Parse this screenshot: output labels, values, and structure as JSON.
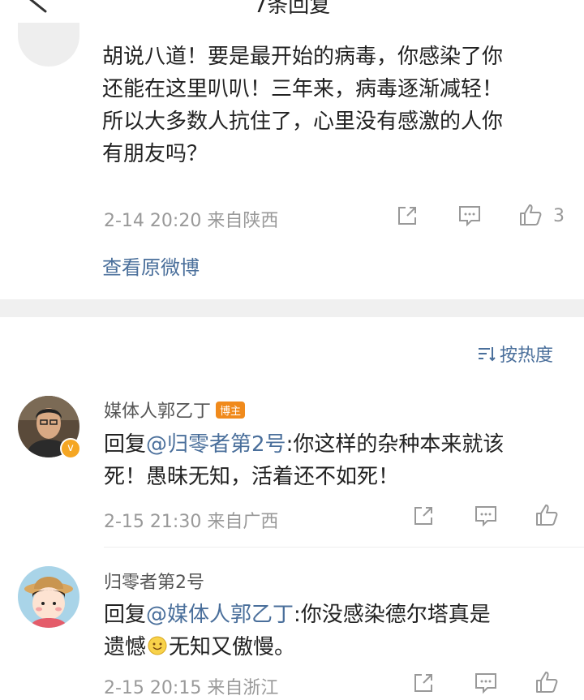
{
  "header": {
    "title": "7条回复"
  },
  "post": {
    "text_lines": [
      "胡说八道！要是最开始的病毒，你感染了你",
      "还能在这里叭叭！三年来，病毒逐渐减轻！",
      "所以大多数人抗住了，心里没有感激的人你",
      "有朋友吗？"
    ],
    "time": "2-14 20:20",
    "location": "来自陕西",
    "like_count": "3",
    "view_original": "查看原微博"
  },
  "sort": {
    "label": "按热度"
  },
  "replies": [
    {
      "username": "媒体人郭乙丁",
      "badge": "博主",
      "prefix": "回复",
      "mention": "@归零者第2号",
      "line1_rest": ":你这样的杂种本来就该",
      "line2": "死！愚昧无知，活着还不如死！",
      "time": "2-15 21:30",
      "location": "来自广西"
    },
    {
      "username": "归零者第2号",
      "prefix": "回复",
      "mention": "@媒体人郭乙丁",
      "line1_rest": ":你没感染德尔塔真是",
      "line2_a": "遗憾",
      "line2_b": "无知又傲慢。",
      "time": "2-15 20:15",
      "location": "来自浙江"
    }
  ],
  "colors": {
    "link": "#4a6f9b",
    "badge": "#f08a1c",
    "meta": "#999999",
    "divider": "#f0f0f0"
  }
}
